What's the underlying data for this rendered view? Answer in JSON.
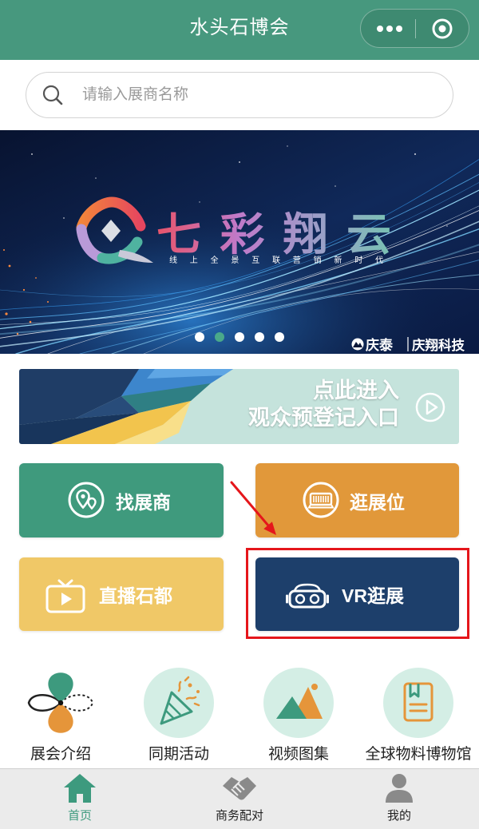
{
  "header": {
    "title": "水头石博会",
    "background": "#47987e",
    "capsule": {
      "more_icon": "more-dots-icon",
      "close_icon": "target-circle-icon"
    }
  },
  "search": {
    "placeholder": "请输入展商名称",
    "icon": "search-icon"
  },
  "banner": {
    "logo_text": "七彩翔云",
    "slogan": "线上全景互联营销新时代",
    "sponsor_primary": "庆泰",
    "sponsor_secondary": "庆翔科技",
    "slide_count": 5,
    "active_slide_index": 1
  },
  "registration": {
    "line1": "点此进入",
    "line2": "观众预登记入口",
    "icon": "play-circle-icon",
    "background": "#c5e3dc"
  },
  "tiles": [
    {
      "label": "找展商",
      "icon": "location-pins-icon",
      "color": "#3f9a7d"
    },
    {
      "label": "逛展位",
      "icon": "booth-ticket-icon",
      "color": "#e1983a"
    },
    {
      "label": "直播石都",
      "icon": "tv-play-icon",
      "color": "#f0c867"
    },
    {
      "label": "VR逛展",
      "icon": "vr-goggles-icon",
      "color": "#1d3f6b"
    }
  ],
  "shortcuts": [
    {
      "label": "展会介绍",
      "icon": "infinity-petal-icon"
    },
    {
      "label": "同期活动",
      "icon": "party-popper-icon"
    },
    {
      "label": "视频图集",
      "icon": "mountains-image-icon"
    },
    {
      "label": "全球物料博物馆",
      "icon": "book-icon"
    }
  ],
  "tabbar": {
    "items": [
      {
        "label": "首页",
        "icon": "home-icon",
        "active": true
      },
      {
        "label": "商务配对",
        "icon": "handshake-icon",
        "active": false
      },
      {
        "label": "我的",
        "icon": "person-icon",
        "active": false
      }
    ],
    "active_color": "#3d9a7e",
    "inactive_icon_color": "#8a8a8a"
  },
  "annotation": {
    "color": "#e5161b"
  }
}
